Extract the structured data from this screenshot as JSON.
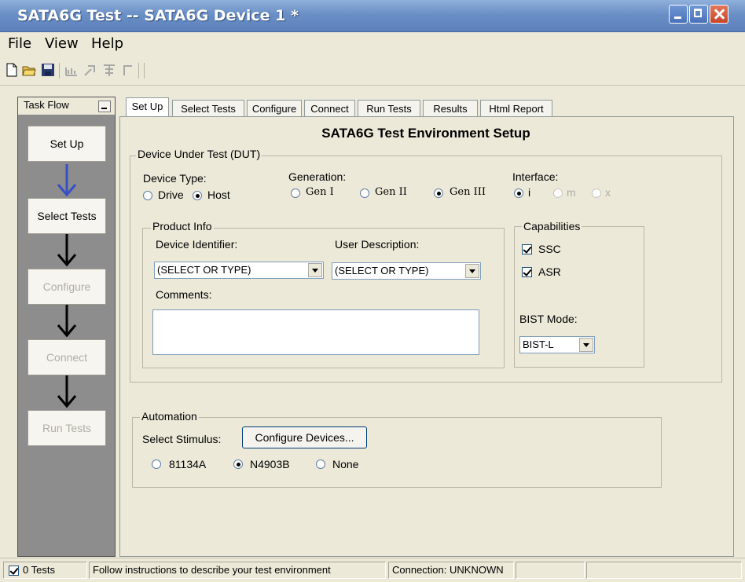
{
  "window": {
    "title": "SATA6G Test -- SATA6G Device 1 *"
  },
  "menu": [
    "File",
    "View",
    "Help"
  ],
  "toolbar": {
    "icons": [
      "new-file-icon",
      "open-folder-icon",
      "save-icon",
      "chart-icon",
      "export-icon",
      "grid-icon",
      "step-icon"
    ]
  },
  "taskflow": {
    "title": "Task Flow",
    "steps": [
      {
        "label": "Set Up",
        "enabled": true
      },
      {
        "label": "Select Tests",
        "enabled": true
      },
      {
        "label": "Configure",
        "enabled": false
      },
      {
        "label": "Connect",
        "enabled": false
      },
      {
        "label": "Run Tests",
        "enabled": false
      }
    ]
  },
  "tabs": [
    "Set Up",
    "Select Tests",
    "Configure",
    "Connect",
    "Run Tests",
    "Results",
    "Html Report"
  ],
  "setup": {
    "heading": "SATA6G Test Environment Setup",
    "dut": {
      "label": "Device Under Test (DUT)",
      "device_type": {
        "label": "Device Type:",
        "options": [
          "Drive",
          "Host"
        ],
        "selected": "Host"
      },
      "generation": {
        "label": "Generation:",
        "options": [
          "Gen I",
          "Gen II",
          "Gen III"
        ],
        "selected": "Gen III"
      },
      "interface": {
        "label": "Interface:",
        "options": [
          "i",
          "m",
          "x"
        ],
        "selected": "i"
      }
    },
    "product_info": {
      "label": "Product Info",
      "device_identifier_label": "Device Identifier:",
      "device_identifier_value": "(SELECT OR TYPE)",
      "user_description_label": "User Description:",
      "user_description_value": "(SELECT OR TYPE)",
      "comments_label": "Comments:",
      "comments_value": ""
    },
    "capabilities": {
      "label": "Capabilities",
      "ssc": "SSC",
      "asr": "ASR",
      "bist_label": "BIST Mode:",
      "bist_value": "BIST-L"
    },
    "automation": {
      "label": "Automation",
      "stimulus_label": "Select Stimulus:",
      "configure_button": "Configure Devices...",
      "options": [
        "81134A",
        "N4903B",
        "None"
      ],
      "selected": "N4903B"
    }
  },
  "status": {
    "tests": "0 Tests",
    "message": "Follow instructions to describe your test environment",
    "connection": "Connection: UNKNOWN"
  },
  "colors": {
    "titlebar": "#6a8fc6",
    "taskflow_bg": "#8d8d8d",
    "arrow_active": "#3a4fc4",
    "arrow": "#000000"
  }
}
